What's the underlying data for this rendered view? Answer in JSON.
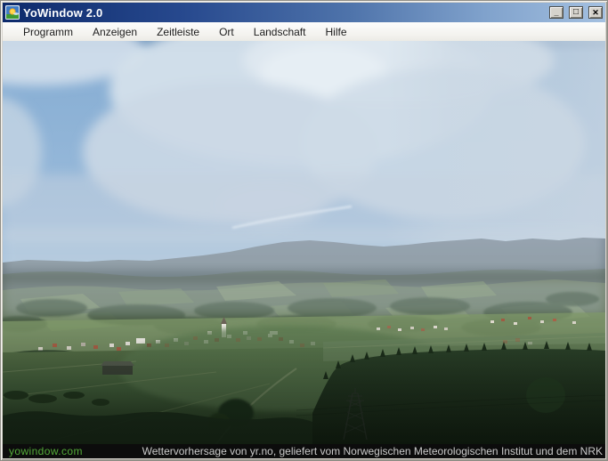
{
  "window": {
    "title": "YoWindow 2.0"
  },
  "icons": {
    "app_logo": "yowindow-sun-landscape",
    "minimize_glyph": "_",
    "maximize_glyph": "□",
    "close_glyph": "✕"
  },
  "menu": {
    "items": [
      {
        "label": "Programm"
      },
      {
        "label": "Anzeigen"
      },
      {
        "label": "Zeitleiste"
      },
      {
        "label": "Ort"
      },
      {
        "label": "Landschaft"
      },
      {
        "label": "Hilfe"
      }
    ]
  },
  "scene": {
    "description": "Landschaftsansicht"
  },
  "statusbar": {
    "link": "yowindow.com",
    "credit": "Wettervorhersage von yr.no, geliefert vom Norwegischen Meteorologischen Institut und dem NRK"
  },
  "colors": {
    "titlebar_gradient_start": "#0d2a6b",
    "titlebar_gradient_end": "#a4c0e0",
    "link_green": "#53aa38",
    "status_bg": "#0c0c0c",
    "status_text": "#c9c9c9",
    "sky_blue": "#8fb4d8"
  }
}
